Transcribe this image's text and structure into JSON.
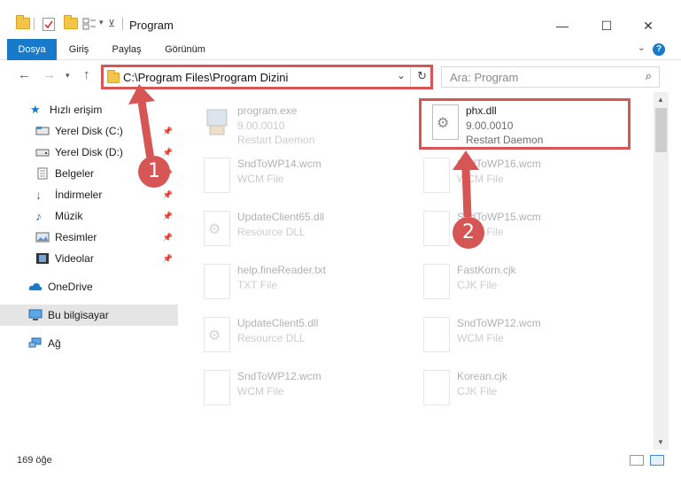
{
  "window": {
    "title": "Program",
    "minimize": "—",
    "maximize": "☐",
    "close": "✕"
  },
  "ribbon": {
    "tabs": [
      {
        "label": "Dosya",
        "active": true
      },
      {
        "label": "Giriş",
        "active": false
      },
      {
        "label": "Paylaş",
        "active": false
      },
      {
        "label": "Görünüm",
        "active": false
      }
    ],
    "help": "?"
  },
  "nav": {
    "back": "←",
    "forward": "→",
    "up": "↑",
    "dropdown": "⌄",
    "address": "C:\\Program Files\\Program Dizini",
    "refresh": "↻",
    "search_placeholder": "Ara: Program",
    "search_icon": "⌕"
  },
  "sidebar": {
    "items": [
      {
        "label": "Hızlı erişim",
        "icon": "star-icon"
      },
      {
        "label": "Yerel Disk (C:)",
        "icon": "drive-icon",
        "pinned": true
      },
      {
        "label": "Yerel Disk (D:)",
        "icon": "drive-icon",
        "pinned": true
      },
      {
        "label": "Belgeler",
        "icon": "documents-icon",
        "pinned": true
      },
      {
        "label": "İndirmeler",
        "icon": "downloads-icon",
        "pinned": true
      },
      {
        "label": "Müzik",
        "icon": "music-icon",
        "pinned": true
      },
      {
        "label": "Resimler",
        "icon": "pictures-icon",
        "pinned": true
      },
      {
        "label": "Videolar",
        "icon": "videos-icon",
        "pinned": true
      },
      {
        "label": "OneDrive",
        "icon": "cloud-icon"
      },
      {
        "label": "Bu bilgisayar",
        "icon": "computer-icon",
        "selected": true
      },
      {
        "label": "Ağ",
        "icon": "network-icon"
      }
    ]
  },
  "files": [
    {
      "name": "program.exe",
      "meta1": "9.00.0010",
      "meta2": "Restart Daemon"
    },
    {
      "name": "phx.dll",
      "meta1": "9.00.0010",
      "meta2": "Restart Daemon",
      "highlighted": true
    },
    {
      "name": "SndToWP14.wcm",
      "meta1": "WCM File"
    },
    {
      "name": "SndToWP16.wcm",
      "meta1": "WCM File"
    },
    {
      "name": "UpdateClient65.dll",
      "meta1": "Resource DLL"
    },
    {
      "name": "SndToWP15.wcm",
      "meta1": "WCM File"
    },
    {
      "name": "help.fineReader.txt",
      "meta1": "TXT File"
    },
    {
      "name": "FastKorn.cjk",
      "meta1": "CJK File"
    },
    {
      "name": "UpdateClient5.dll",
      "meta1": "Resource DLL"
    },
    {
      "name": "SndToWP12.wcm",
      "meta1": "WCM File"
    },
    {
      "name": "SndToWP12.wcm",
      "meta1": "WCM File"
    },
    {
      "name": "Korean.cjk",
      "meta1": "CJK File"
    }
  ],
  "status": {
    "count": "169 öğe"
  },
  "callouts": [
    "1",
    "2"
  ],
  "colors": {
    "accent": "#1979ca",
    "annotation": "#d65656"
  }
}
